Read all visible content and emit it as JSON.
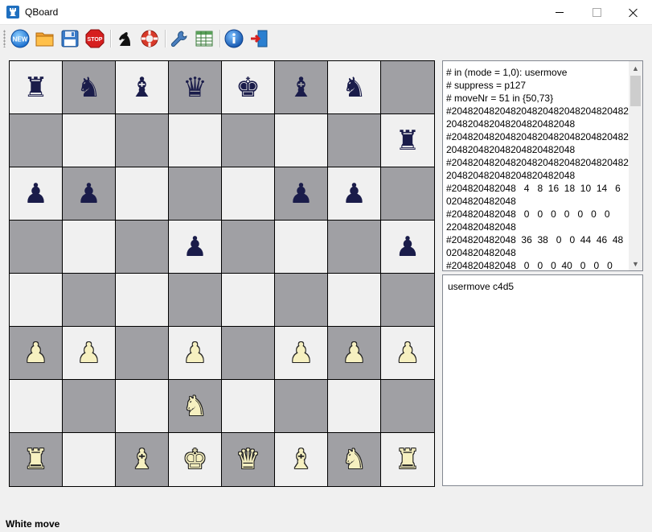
{
  "window": {
    "title": "QBoard"
  },
  "toolbar": {
    "buttons": [
      {
        "id": "new",
        "label": "NEW",
        "icon": "new-icon"
      },
      {
        "id": "open",
        "icon": "folder-icon"
      },
      {
        "id": "save",
        "icon": "floppy-icon"
      },
      {
        "id": "stop",
        "label": "STOP",
        "icon": "stop-icon"
      },
      {
        "id": "engine",
        "icon": "knight-icon"
      },
      {
        "id": "help",
        "icon": "lifebuoy-icon"
      },
      {
        "id": "settings",
        "icon": "wrench-icon"
      },
      {
        "id": "table",
        "icon": "table-icon"
      },
      {
        "id": "info",
        "icon": "info-icon"
      },
      {
        "id": "exit",
        "icon": "exit-icon"
      }
    ]
  },
  "board": {
    "ranks": [
      [
        "♜",
        "♞",
        "♝",
        "♛",
        "♚",
        "♝",
        "♞",
        ""
      ],
      [
        "",
        "",
        "",
        "",
        "",
        "",
        "",
        "♜"
      ],
      [
        "♟",
        "♟",
        "",
        "",
        "",
        "♟",
        "♟",
        ""
      ],
      [
        "",
        "",
        "",
        "♟",
        "",
        "",
        "",
        "♟"
      ],
      [
        "",
        "",
        "",
        "",
        "",
        "",
        "",
        ""
      ],
      [
        "♙",
        "♙",
        "",
        "♙",
        "",
        "♙",
        "♙",
        "♙"
      ],
      [
        "",
        "",
        "",
        "♘",
        "",
        "",
        "",
        ""
      ],
      [
        "♖",
        "",
        "♗",
        "♔",
        "♕",
        "♗",
        "♘",
        "♖"
      ]
    ],
    "colors": [
      [
        "b",
        "b",
        "b",
        "b",
        "b",
        "b",
        "b",
        ""
      ],
      [
        "",
        "",
        "",
        "",
        "",
        "",
        "",
        "b"
      ],
      [
        "b",
        "b",
        "",
        "",
        "",
        "b",
        "b",
        ""
      ],
      [
        "",
        "",
        "",
        "b",
        "",
        "",
        "",
        "b"
      ],
      [
        "",
        "",
        "",
        "",
        "",
        "",
        "",
        ""
      ],
      [
        "w",
        "w",
        "",
        "w",
        "",
        "w",
        "w",
        "w"
      ],
      [
        "",
        "",
        "",
        "w",
        "",
        "",
        "",
        ""
      ],
      [
        "w",
        "",
        "w",
        "w",
        "w",
        "w",
        "w",
        "w"
      ]
    ],
    "light_color": "#f0f0f0",
    "dark_color": "#a0a0a4"
  },
  "log": {
    "lines": [
      "# in (mode = 1,0): usermove",
      "# suppress = p127",
      "# moveNr = 51 in {50,73}",
      "#204820482048204820482048204820482048",
      "204820482048204820482048",
      "#204820482048204820482048204820482048",
      "204820482048204820482048",
      "#204820482048204820482048204820482048",
      "204820482048204820482048",
      "#204820482048   4   8  16  18  10  14   6",
      "0204820482048",
      "#204820482048   0   0   0   0   0   0   0",
      "2204820482048",
      "#204820482048  36  38   0   0  44  46  48",
      "0204820482048",
      "#204820482048   0   0   0  40   0   0   0"
    ]
  },
  "command": {
    "text": "usermove c4d5"
  },
  "status": {
    "text": "White move"
  }
}
